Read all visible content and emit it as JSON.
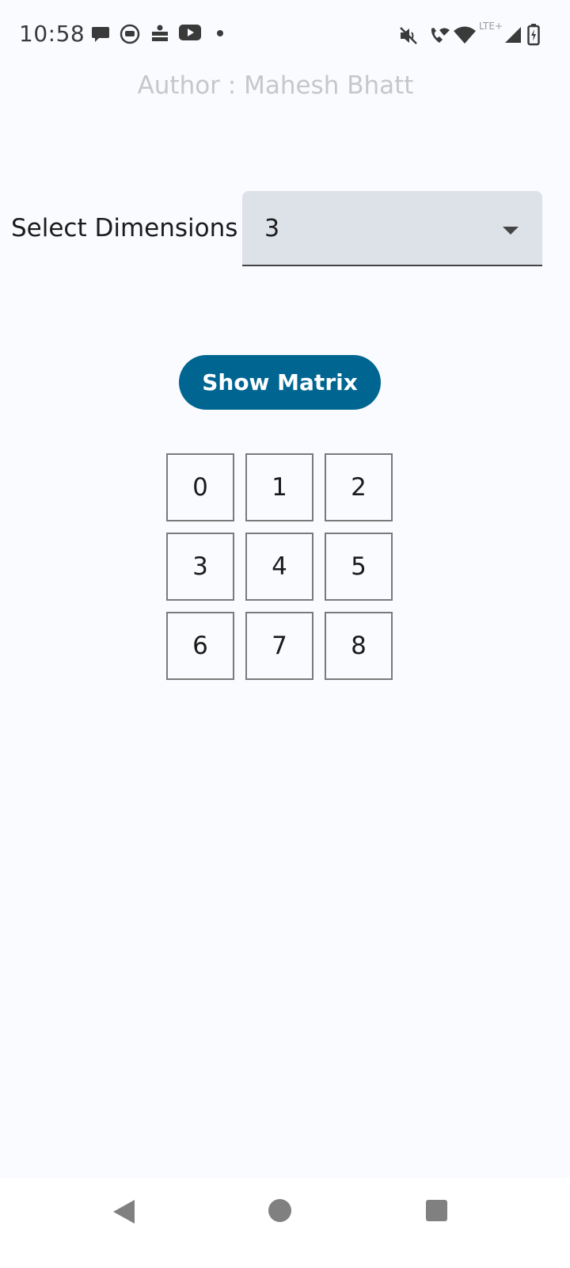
{
  "status_bar": {
    "time": "10:58",
    "notifications": [
      "chat-bubble-icon",
      "cat-face-icon",
      "newspaper-app-icon",
      "youtube-icon",
      "more-dot-icon"
    ],
    "system_icons": [
      "mute-icon",
      "wifi-calling-icon",
      "wifi-icon",
      "lte-signal-icon",
      "battery-charging-icon"
    ],
    "network_label": "LTE+"
  },
  "author": "Author : Mahesh Bhatt",
  "dimension_select": {
    "label": "Select Dimensions",
    "value": "3"
  },
  "show_button": {
    "label": "Show Matrix"
  },
  "matrix": {
    "cells": [
      "0",
      "1",
      "2",
      "3",
      "4",
      "5",
      "6",
      "7",
      "8"
    ]
  },
  "colors": {
    "background": "#f9fbff",
    "button": "#006691",
    "select_bg": "#dde2e9"
  },
  "nav_bar": {
    "items": [
      "back-icon",
      "home-icon",
      "recents-icon"
    ]
  }
}
